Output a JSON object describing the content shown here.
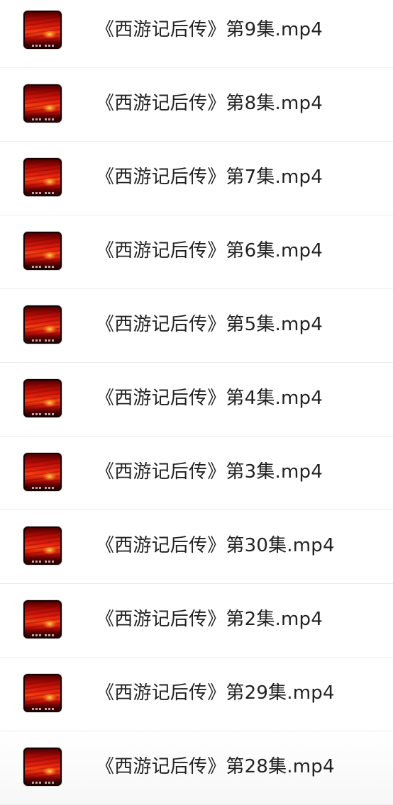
{
  "file_list": {
    "items": [
      {
        "name": "《西游记后传》第9集.mp4",
        "icon": "video-thumbnail-icon"
      },
      {
        "name": "《西游记后传》第8集.mp4",
        "icon": "video-thumbnail-icon"
      },
      {
        "name": "《西游记后传》第7集.mp4",
        "icon": "video-thumbnail-icon"
      },
      {
        "name": "《西游记后传》第6集.mp4",
        "icon": "video-thumbnail-icon"
      },
      {
        "name": "《西游记后传》第5集.mp4",
        "icon": "video-thumbnail-icon"
      },
      {
        "name": "《西游记后传》第4集.mp4",
        "icon": "video-thumbnail-icon"
      },
      {
        "name": "《西游记后传》第3集.mp4",
        "icon": "video-thumbnail-icon"
      },
      {
        "name": "《西游记后传》第30集.mp4",
        "icon": "video-thumbnail-icon"
      },
      {
        "name": "《西游记后传》第2集.mp4",
        "icon": "video-thumbnail-icon"
      },
      {
        "name": "《西游记后传》第29集.mp4",
        "icon": "video-thumbnail-icon"
      },
      {
        "name": "《西游记后传》第28集.mp4",
        "icon": "video-thumbnail-icon"
      }
    ]
  },
  "colors": {
    "text": "#222222",
    "divider": "#ececec",
    "background": "#ffffff",
    "thumbnail_red": "#e5230f"
  }
}
